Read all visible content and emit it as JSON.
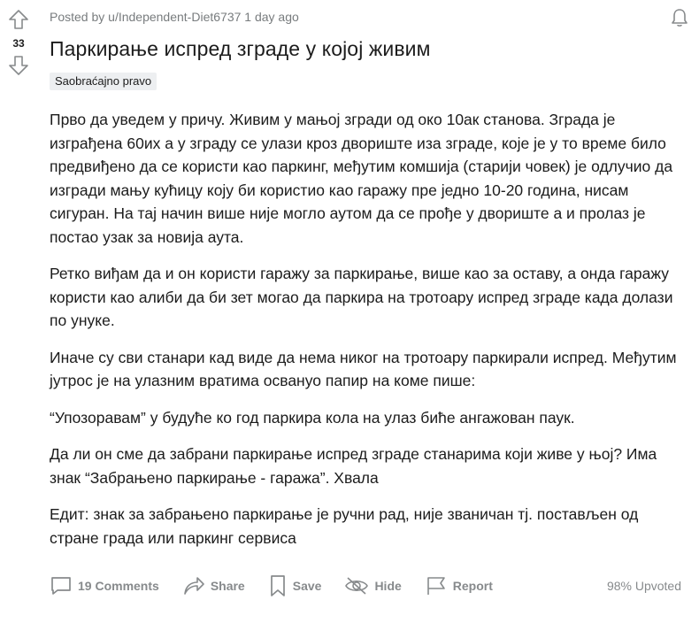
{
  "vote": {
    "score": "33"
  },
  "post": {
    "meta": "Posted by u/Independent-Diet6737 1 day ago",
    "title": "Паркирање испред зграде у којој живим",
    "flair": "Saobraćajno pravo",
    "paragraphs": [
      "Прво да уведем у причу. Живим у мањој згради од око 10ак станова. Зграда је изграђена 60их а у зграду се улази кроз двориште иза зграде, које је у то време било предвиђено да се користи као паркинг, међутим комшија (старији човек) је одлучио да изгради мању кућицу коју би користио као гаражу пре једно 10-20 година, нисам сигуран. На тај начин више није могло аутом да се прође у двориште а и пролаз је постао узак за новија аута.",
      "Ретко виђам да и он користи гаражу за паркирање, више као за оставу, а онда гаражу користи као алиби да би зет могао да паркира на тротоару испред зграде када долази по унуке.",
      "Иначе су сви станари кад виде да нема никог на тротоару паркирали испред. Међутим јутрос је на улазним вратима освануо папир на коме пише:",
      "“Упозоравам” у будуће ко год паркира кола на улаз биће ангажован паук.",
      "Да ли он сме да забрани паркирање испред зграде станарима који живе у њој? Има знак “Забрањено паркирање - гаража”. Хвала",
      "Едит: знак за забрањено паркирање је ручни рад, није званичан тј. постављен од стране града или паркинг сервиса"
    ]
  },
  "actions": {
    "comments": "19 Comments",
    "share": "Share",
    "save": "Save",
    "hide": "Hide",
    "report": "Report",
    "upvoted": "98% Upvoted"
  },
  "icons": {
    "upvote": "upvote-arrow-icon",
    "downvote": "downvote-arrow-icon",
    "bell": "bell-icon",
    "comment": "comment-icon",
    "share": "share-icon",
    "save": "bookmark-icon",
    "hide": "eye-slash-icon",
    "report": "flag-icon"
  },
  "colors": {
    "text": "#1c1c1c",
    "muted": "#878a8c",
    "flair_bg": "#edeff1"
  }
}
